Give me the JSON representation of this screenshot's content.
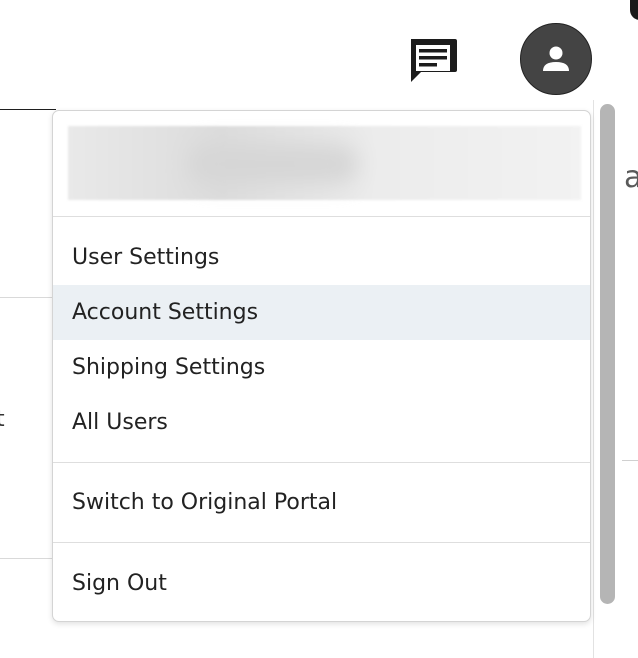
{
  "header": {
    "icons": {
      "messages": "chat-icon",
      "account": "person-icon"
    },
    "avatar_color": "#444444"
  },
  "menu": {
    "items": [
      {
        "label": "User Settings"
      },
      {
        "label": "Account Settings"
      },
      {
        "label": "Shipping Settings"
      },
      {
        "label": "All Users"
      }
    ],
    "switch_portal_label": "Switch to Original Portal",
    "sign_out_label": "Sign Out",
    "hover_color": "#ebf0f4"
  },
  "background": {
    "partial_right_char": "a",
    "partial_left_char": "t"
  }
}
